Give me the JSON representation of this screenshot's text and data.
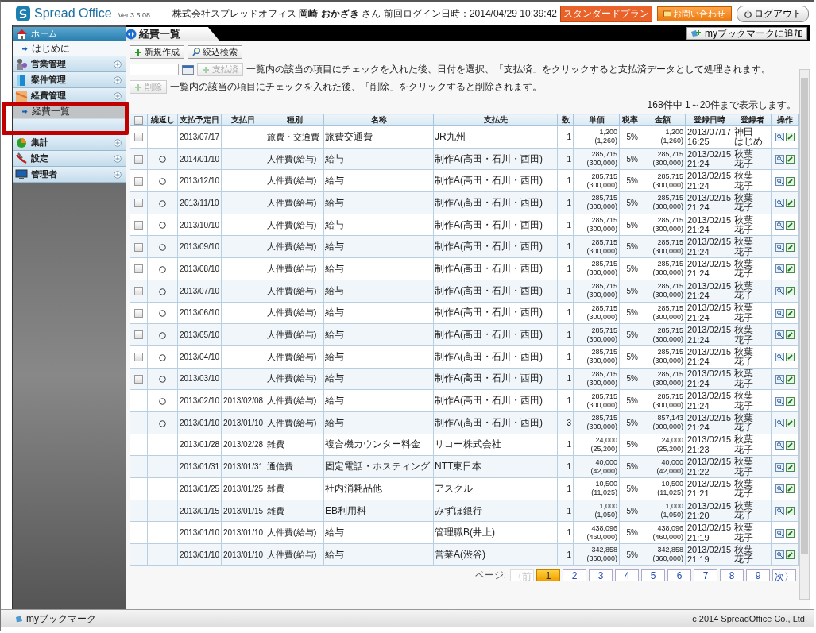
{
  "header": {
    "logo": "Spread Office",
    "version": "Ver.3.5.08",
    "user_line": "株式会社スプレッドオフィス **岡崎 おかざき** さん",
    "last_login": "前回ログイン日時：2014/04/29 10:39:42",
    "plan": "スタンダードプラン",
    "contact_button": "お問い合わせ",
    "logout_button": "ログアウト"
  },
  "sidebar": {
    "items": [
      {
        "kind": "home",
        "label": "ホーム",
        "selected": false,
        "highlighted": false
      },
      {
        "kind": "link",
        "label": "はじめに",
        "selected": false,
        "highlighted": false
      },
      {
        "kind": "section",
        "label": "営業管理",
        "selected": false,
        "highlighted": false
      },
      {
        "kind": "section",
        "label": "案件管理",
        "selected": false,
        "highlighted": false
      },
      {
        "kind": "section",
        "label": "経費管理",
        "selected": false,
        "highlighted": false
      },
      {
        "kind": "link",
        "label": "経費一覧",
        "selected": true,
        "highlighted": true
      },
      {
        "kind": "section",
        "label": "集計",
        "selected": false,
        "highlighted": false
      },
      {
        "kind": "section",
        "label": "設定",
        "selected": false,
        "highlighted": false
      },
      {
        "kind": "section",
        "label": "管理者",
        "selected": false,
        "highlighted": false
      }
    ]
  },
  "tab": {
    "label": "経費一覧"
  },
  "bookmark_button": "myブックマークに追加",
  "toolbar": {
    "new_button": "新規作成",
    "filter_button": "絞込検索",
    "paid_button": {
      "label": "支払済",
      "disabled": true
    },
    "paid_note": "一覧内の該当の項目にチェックを入れた後、日付を選択、「支払済」をクリックすると支払済データとして処理されます。",
    "delete_button": {
      "label": "削除",
      "disabled": true
    },
    "delete_note": "一覧内の該当の項目にチェックを入れた後、「削除」をクリックすると削除されます。"
  },
  "summary": "168件中 1～20件まで表示します。",
  "table": {
    "select_all": {
      "checked": false
    },
    "columns": [
      "繰返し",
      "支払予定日",
      "支払日",
      "種別",
      "名称",
      "支払先",
      "数",
      "単価",
      "税率",
      "金額",
      "登録日時",
      "登録者",
      "操作"
    ],
    "rows": [
      {
        "selectable": true,
        "checked": false,
        "repeat": false,
        "scheduled_date": "2013/07/17",
        "category": "旅費・交通費",
        "name": "旅費交通費",
        "payee": "JR九州",
        "quantity": "1",
        "unit_price": [
          "1,200",
          "(1,260)"
        ],
        "tax_rate": "5%",
        "amount": [
          "1,200",
          "(1,260)"
        ],
        "registered": [
          "2013/07/17",
          "16:25"
        ],
        "registrant": [
          "神田",
          "はじめ"
        ]
      },
      {
        "selectable": true,
        "checked": false,
        "repeat": true,
        "scheduled_date": "2014/01/10",
        "category": "人件費(給与)",
        "name": "給与",
        "payee": "制作A(高田・石川・西田)",
        "quantity": "1",
        "unit_price": [
          "285,715",
          "(300,000)"
        ],
        "tax_rate": "5%",
        "amount": [
          "285,715",
          "(300,000)"
        ],
        "registered": [
          "2013/02/15",
          "21:24"
        ],
        "registrant": [
          "秋葉",
          "花子"
        ]
      },
      {
        "selectable": true,
        "checked": false,
        "repeat": true,
        "scheduled_date": "2013/12/10",
        "category": "人件費(給与)",
        "name": "給与",
        "payee": "制作A(高田・石川・西田)",
        "quantity": "1",
        "unit_price": [
          "285,715",
          "(300,000)"
        ],
        "tax_rate": "5%",
        "amount": [
          "285,715",
          "(300,000)"
        ],
        "registered": [
          "2013/02/15",
          "21:24"
        ],
        "registrant": [
          "秋葉",
          "花子"
        ]
      },
      {
        "selectable": true,
        "checked": false,
        "repeat": true,
        "scheduled_date": "2013/11/10",
        "category": "人件費(給与)",
        "name": "給与",
        "payee": "制作A(高田・石川・西田)",
        "quantity": "1",
        "unit_price": [
          "285,715",
          "(300,000)"
        ],
        "tax_rate": "5%",
        "amount": [
          "285,715",
          "(300,000)"
        ],
        "registered": [
          "2013/02/15",
          "21:24"
        ],
        "registrant": [
          "秋葉",
          "花子"
        ]
      },
      {
        "selectable": true,
        "checked": false,
        "repeat": true,
        "scheduled_date": "2013/10/10",
        "category": "人件費(給与)",
        "name": "給与",
        "payee": "制作A(高田・石川・西田)",
        "quantity": "1",
        "unit_price": [
          "285,715",
          "(300,000)"
        ],
        "tax_rate": "5%",
        "amount": [
          "285,715",
          "(300,000)"
        ],
        "registered": [
          "2013/02/15",
          "21:24"
        ],
        "registrant": [
          "秋葉",
          "花子"
        ]
      },
      {
        "selectable": true,
        "checked": false,
        "repeat": true,
        "scheduled_date": "2013/09/10",
        "category": "人件費(給与)",
        "name": "給与",
        "payee": "制作A(高田・石川・西田)",
        "quantity": "1",
        "unit_price": [
          "285,715",
          "(300,000)"
        ],
        "tax_rate": "5%",
        "amount": [
          "285,715",
          "(300,000)"
        ],
        "registered": [
          "2013/02/15",
          "21:24"
        ],
        "registrant": [
          "秋葉",
          "花子"
        ]
      },
      {
        "selectable": true,
        "checked": false,
        "repeat": true,
        "scheduled_date": "2013/08/10",
        "category": "人件費(給与)",
        "name": "給与",
        "payee": "制作A(高田・石川・西田)",
        "quantity": "1",
        "unit_price": [
          "285,715",
          "(300,000)"
        ],
        "tax_rate": "5%",
        "amount": [
          "285,715",
          "(300,000)"
        ],
        "registered": [
          "2013/02/15",
          "21:24"
        ],
        "registrant": [
          "秋葉",
          "花子"
        ]
      },
      {
        "selectable": true,
        "checked": false,
        "repeat": true,
        "scheduled_date": "2013/07/10",
        "category": "人件費(給与)",
        "name": "給与",
        "payee": "制作A(高田・石川・西田)",
        "quantity": "1",
        "unit_price": [
          "285,715",
          "(300,000)"
        ],
        "tax_rate": "5%",
        "amount": [
          "285,715",
          "(300,000)"
        ],
        "registered": [
          "2013/02/15",
          "21:24"
        ],
        "registrant": [
          "秋葉",
          "花子"
        ]
      },
      {
        "selectable": true,
        "checked": false,
        "repeat": true,
        "scheduled_date": "2013/06/10",
        "category": "人件費(給与)",
        "name": "給与",
        "payee": "制作A(高田・石川・西田)",
        "quantity": "1",
        "unit_price": [
          "285,715",
          "(300,000)"
        ],
        "tax_rate": "5%",
        "amount": [
          "285,715",
          "(300,000)"
        ],
        "registered": [
          "2013/02/15",
          "21:24"
        ],
        "registrant": [
          "秋葉",
          "花子"
        ]
      },
      {
        "selectable": true,
        "checked": false,
        "repeat": true,
        "scheduled_date": "2013/05/10",
        "category": "人件費(給与)",
        "name": "給与",
        "payee": "制作A(高田・石川・西田)",
        "quantity": "1",
        "unit_price": [
          "285,715",
          "(300,000)"
        ],
        "tax_rate": "5%",
        "amount": [
          "285,715",
          "(300,000)"
        ],
        "registered": [
          "2013/02/15",
          "21:24"
        ],
        "registrant": [
          "秋葉",
          "花子"
        ]
      },
      {
        "selectable": true,
        "checked": false,
        "repeat": true,
        "scheduled_date": "2013/04/10",
        "category": "人件費(給与)",
        "name": "給与",
        "payee": "制作A(高田・石川・西田)",
        "quantity": "1",
        "unit_price": [
          "285,715",
          "(300,000)"
        ],
        "tax_rate": "5%",
        "amount": [
          "285,715",
          "(300,000)"
        ],
        "registered": [
          "2013/02/15",
          "21:24"
        ],
        "registrant": [
          "秋葉",
          "花子"
        ]
      },
      {
        "selectable": true,
        "checked": false,
        "repeat": true,
        "scheduled_date": "2013/03/10",
        "category": "人件費(給与)",
        "name": "給与",
        "payee": "制作A(高田・石川・西田)",
        "quantity": "1",
        "unit_price": [
          "285,715",
          "(300,000)"
        ],
        "tax_rate": "5%",
        "amount": [
          "285,715",
          "(300,000)"
        ],
        "registered": [
          "2013/02/15",
          "21:24"
        ],
        "registrant": [
          "秋葉",
          "花子"
        ]
      },
      {
        "selectable": false,
        "repeat": true,
        "scheduled_date": "2013/02/10",
        "paid_date": "2013/02/08",
        "category": "人件費(給与)",
        "name": "給与",
        "payee": "制作A(高田・石川・西田)",
        "quantity": "1",
        "unit_price": [
          "285,715",
          "(300,000)"
        ],
        "tax_rate": "5%",
        "amount": [
          "285,715",
          "(300,000)"
        ],
        "registered": [
          "2013/02/15",
          "21:24"
        ],
        "registrant": [
          "秋葉",
          "花子"
        ]
      },
      {
        "selectable": false,
        "repeat": true,
        "scheduled_date": "2013/01/10",
        "paid_date": "2013/01/10",
        "category": "人件費(給与)",
        "name": "給与",
        "payee": "制作A(高田・石川・西田)",
        "quantity": "3",
        "unit_price": [
          "285,715",
          "(300,000)"
        ],
        "tax_rate": "5%",
        "amount": [
          "857,143",
          "(900,000)"
        ],
        "registered": [
          "2013/02/15",
          "21:24"
        ],
        "registrant": [
          "秋葉",
          "花子"
        ]
      },
      {
        "selectable": false,
        "repeat": false,
        "scheduled_date": "2013/01/28",
        "paid_date": "2013/02/28",
        "category": "雑費",
        "name": "複合機カウンター料金",
        "payee": "リコー株式会社",
        "quantity": "1",
        "unit_price": [
          "24,000",
          "(25,200)"
        ],
        "tax_rate": "5%",
        "amount": [
          "24,000",
          "(25,200)"
        ],
        "registered": [
          "2013/02/15",
          "21:23"
        ],
        "registrant": [
          "秋葉",
          "花子"
        ]
      },
      {
        "selectable": false,
        "repeat": false,
        "scheduled_date": "2013/01/31",
        "paid_date": "2013/01/31",
        "category": "通信費",
        "name": "固定電話・ホスティング",
        "payee": "NTT東日本",
        "quantity": "1",
        "unit_price": [
          "40,000",
          "(42,000)"
        ],
        "tax_rate": "5%",
        "amount": [
          "40,000",
          "(42,000)"
        ],
        "registered": [
          "2013/02/15",
          "21:22"
        ],
        "registrant": [
          "秋葉",
          "花子"
        ]
      },
      {
        "selectable": false,
        "repeat": false,
        "scheduled_date": "2013/01/25",
        "paid_date": "2013/01/25",
        "category": "雑費",
        "name": "社内消耗品他",
        "payee": "アスクル",
        "quantity": "1",
        "unit_price": [
          "10,500",
          "(11,025)"
        ],
        "tax_rate": "5%",
        "amount": [
          "10,500",
          "(11,025)"
        ],
        "registered": [
          "2013/02/15",
          "21:21"
        ],
        "registrant": [
          "秋葉",
          "花子"
        ]
      },
      {
        "selectable": false,
        "repeat": false,
        "scheduled_date": "2013/01/15",
        "paid_date": "2013/01/15",
        "category": "雑費",
        "name": "EB利用料",
        "payee": "みずほ銀行",
        "quantity": "1",
        "unit_price": [
          "1,000",
          "(1,050)"
        ],
        "tax_rate": "5%",
        "amount": [
          "1,000",
          "(1,050)"
        ],
        "registered": [
          "2013/02/15",
          "21:20"
        ],
        "registrant": [
          "秋葉",
          "花子"
        ]
      },
      {
        "selectable": false,
        "repeat": false,
        "scheduled_date": "2013/01/10",
        "paid_date": "2013/01/10",
        "category": "人件費(給与)",
        "name": "給与",
        "payee": "管理職B(井上)",
        "quantity": "1",
        "unit_price": [
          "438,096",
          "(460,000)"
        ],
        "tax_rate": "5%",
        "amount": [
          "438,096",
          "(460,000)"
        ],
        "registered": [
          "2013/02/15",
          "21:19"
        ],
        "registrant": [
          "秋葉",
          "花子"
        ]
      },
      {
        "selectable": false,
        "repeat": false,
        "scheduled_date": "2013/01/10",
        "paid_date": "2013/01/10",
        "category": "人件費(給与)",
        "name": "給与",
        "payee": "営業A(渋谷)",
        "quantity": "1",
        "unit_price": [
          "342,858",
          "(360,000)"
        ],
        "tax_rate": "5%",
        "amount": [
          "342,858",
          "(360,000)"
        ],
        "registered": [
          "2013/02/15",
          "21:19"
        ],
        "registrant": [
          "秋葉",
          "花子"
        ]
      }
    ]
  },
  "pagination": {
    "label": "ページ:",
    "prev": {
      "label": "〈前",
      "disabled": true
    },
    "pages": [
      {
        "label": "1",
        "selected": true
      },
      {
        "label": "2",
        "selected": false
      },
      {
        "label": "3",
        "selected": false
      },
      {
        "label": "4",
        "selected": false
      },
      {
        "label": "5",
        "selected": false
      },
      {
        "label": "6",
        "selected": false
      },
      {
        "label": "7",
        "selected": false
      },
      {
        "label": "8",
        "selected": false
      },
      {
        "label": "9",
        "selected": false
      }
    ],
    "next": {
      "label": "次〉",
      "disabled": false
    }
  },
  "footer": {
    "bookmark": "myブックマーク",
    "copyright": "c 2014 SpreadOffice Co., Ltd."
  }
}
